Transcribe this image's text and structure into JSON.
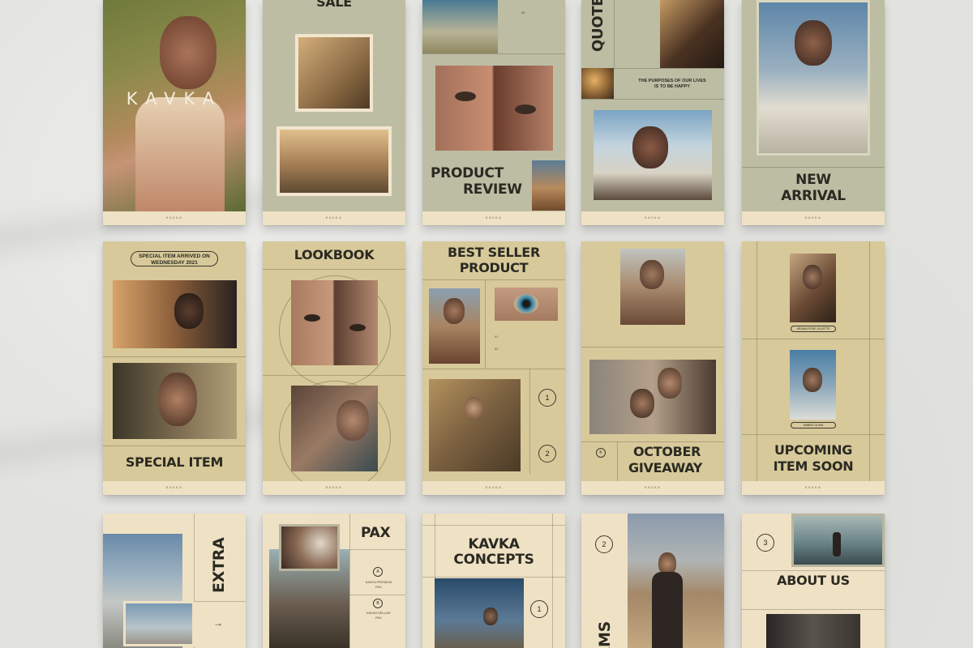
{
  "brand": "KAVKA",
  "cards": {
    "c1": {
      "logo": "KAVKA"
    },
    "c2": {
      "title": "SALE"
    },
    "c3": {
      "title_line1": "PRODUCT",
      "title_line2": "REVIEW",
      "small_number": "05"
    },
    "c4": {
      "title": "QUOTE",
      "quote_line1": "THE PURPOSES OF OUR LIVES",
      "quote_line2": "IS TO BE HAPPY"
    },
    "c5": {
      "title_line1": "NEW",
      "title_line2": "ARRIVAL"
    },
    "c6": {
      "pill_line1": "SPECIAL ITEM ARRIVED ON",
      "pill_line2": "WEDNESDAY 2021",
      "title": "SPECIAL ITEM"
    },
    "c7": {
      "title": "LOOKBOOK"
    },
    "c8": {
      "title_line1": "BEST SELLER",
      "title_line2": "PRODUCT",
      "num_a": "01",
      "num_b": "02",
      "circle1": "1",
      "circle2": "2"
    },
    "c9": {
      "title_line1": "OCTOBER",
      "title_line2": "GIVEAWAY",
      "logo_letter": "K"
    },
    "c10": {
      "tag1": "ARIANA ROSE JULIETTE",
      "tag2": "AMBER OLIVIA",
      "title_line1": "UPCOMING",
      "title_line2": "ITEM SOON"
    },
    "c11": {
      "title": "EXTRA",
      "arrow": "→"
    },
    "c12": {
      "title": "PAX",
      "item_a_letter": "A",
      "item_a_line1": "KAVKA PREMIUM",
      "item_a_line2": "PAX",
      "item_b_letter": "B",
      "item_b_line1": "KAVKA DELUXE",
      "item_b_line2": "PAX"
    },
    "c13": {
      "title_line1": "KAVKA",
      "title_line2": "CONCEPTS",
      "circle": "1"
    },
    "c14": {
      "circle": "2",
      "title": "ERMS"
    },
    "c15": {
      "circle": "3",
      "title": "ABOUT US"
    }
  }
}
